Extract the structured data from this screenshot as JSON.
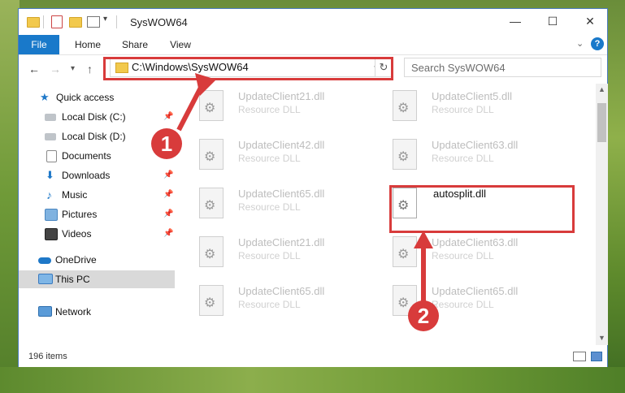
{
  "window": {
    "title": "SysWOW64",
    "controls": {
      "minimize": "—",
      "maximize": "☐",
      "close": "✕"
    }
  },
  "ribbon": {
    "tabs": [
      "File",
      "Home",
      "Share",
      "View"
    ],
    "help": "?"
  },
  "address": {
    "path": "C:\\Windows\\SysWOW64",
    "search_placeholder": "Search SysWOW64"
  },
  "nav": {
    "items": [
      {
        "label": "Quick access",
        "icon": "star-icon"
      },
      {
        "label": "Local Disk (C:)",
        "icon": "drive-icon",
        "pinned": true
      },
      {
        "label": "Local Disk (D:)",
        "icon": "drive-icon"
      },
      {
        "label": "Documents",
        "icon": "documents-icon",
        "pinned": true
      },
      {
        "label": "Downloads",
        "icon": "downloads-icon",
        "pinned": true
      },
      {
        "label": "Music",
        "icon": "music-icon",
        "pinned": true
      },
      {
        "label": "Pictures",
        "icon": "pictures-icon",
        "pinned": true
      },
      {
        "label": "Videos",
        "icon": "videos-icon",
        "pinned": true
      },
      {
        "label": "OneDrive",
        "icon": "onedrive-icon"
      },
      {
        "label": "This PC",
        "icon": "this-pc-icon",
        "selected": true
      },
      {
        "label": "Network",
        "icon": "network-icon"
      }
    ]
  },
  "files": {
    "left": [
      {
        "name": "UpdateClient21.dll",
        "type": "Resource DLL"
      },
      {
        "name": "UpdateClient42.dll",
        "type": "Resource DLL"
      },
      {
        "name": "UpdateClient65.dll",
        "type": "Resource DLL"
      },
      {
        "name": "UpdateClient21.dll",
        "type": "Resource DLL"
      },
      {
        "name": "UpdateClient65.dll",
        "type": "Resource DLL"
      }
    ],
    "right": [
      {
        "name": "UpdateClient5.dll",
        "type": "Resource DLL"
      },
      {
        "name": "UpdateClient63.dll",
        "type": "Resource DLL"
      },
      {
        "name": "autosplit.dll",
        "type": "",
        "highlighted": true
      },
      {
        "name": "UpdateClient63.dll",
        "type": "Resource DLL"
      },
      {
        "name": "UpdateClient65.dll",
        "type": "Resource DLL"
      }
    ]
  },
  "status": {
    "count": "196 items"
  },
  "annotations": {
    "marker1": "1",
    "marker2": "2"
  },
  "colors": {
    "accent": "#1979ca",
    "annotation": "#d83b3b"
  }
}
